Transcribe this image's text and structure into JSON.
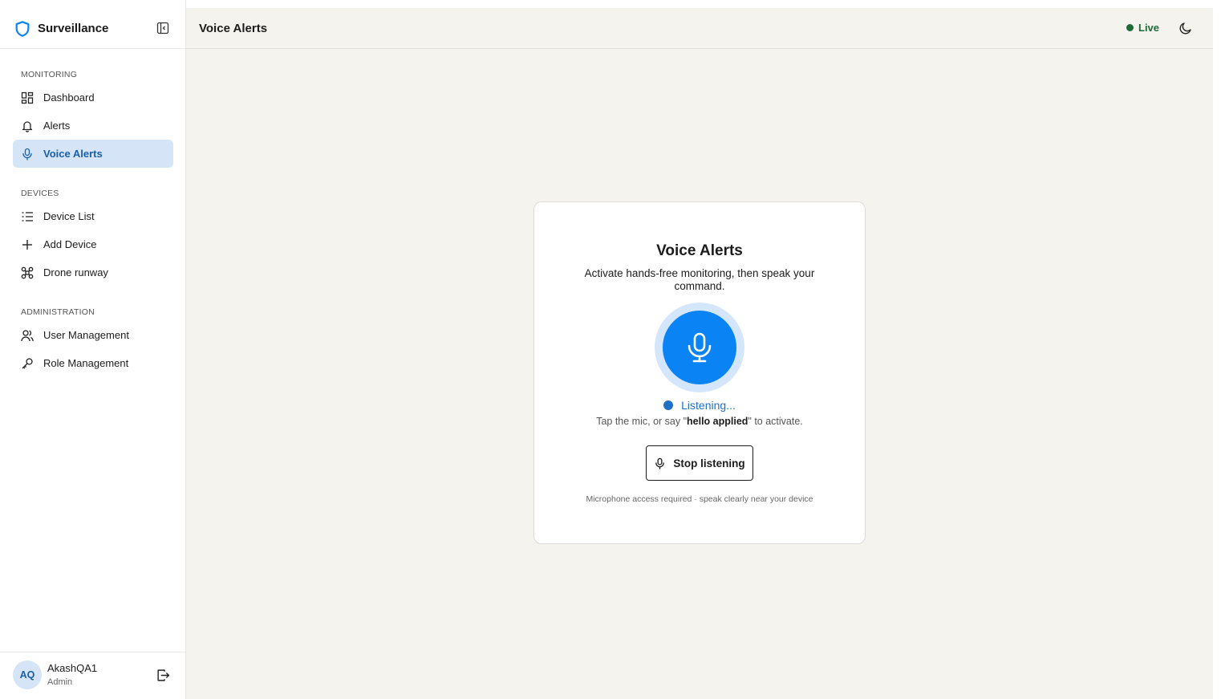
{
  "brand": {
    "name": "Surveillance",
    "logo_icon": "shield-icon",
    "accent": "#0a84f5"
  },
  "sidebar": {
    "sections": [
      {
        "label": "MONITORING",
        "items": [
          {
            "label": "Dashboard",
            "icon": "dashboard-icon"
          },
          {
            "label": "Alerts",
            "icon": "bell-icon"
          },
          {
            "label": "Voice Alerts",
            "icon": "mic-icon",
            "active": true
          }
        ]
      },
      {
        "label": "DEVICES",
        "items": [
          {
            "label": "Device List",
            "icon": "list-icon"
          },
          {
            "label": "Add Device",
            "icon": "plus-icon"
          },
          {
            "label": "Drone runway",
            "icon": "drone-icon"
          }
        ]
      },
      {
        "label": "ADMINISTRATION",
        "items": [
          {
            "label": "User Management",
            "icon": "users-icon"
          },
          {
            "label": "Role Management",
            "icon": "key-icon"
          }
        ]
      }
    ]
  },
  "user": {
    "initials": "AQ",
    "name": "AkashQA1",
    "role": "Admin"
  },
  "header": {
    "title": "Voice Alerts",
    "status": "Live",
    "status_color": "#1e6b3a"
  },
  "card": {
    "title": "Voice Alerts",
    "description": "Activate hands-free monitoring, then speak your command.",
    "status": "Listening...",
    "hint_prefix": "Tap the mic, or say \"",
    "hint_keyword": "hello applied",
    "hint_suffix": "\" to activate.",
    "stop_label": "Stop listening",
    "footnote": "Microphone access required · speak clearly near your device"
  }
}
